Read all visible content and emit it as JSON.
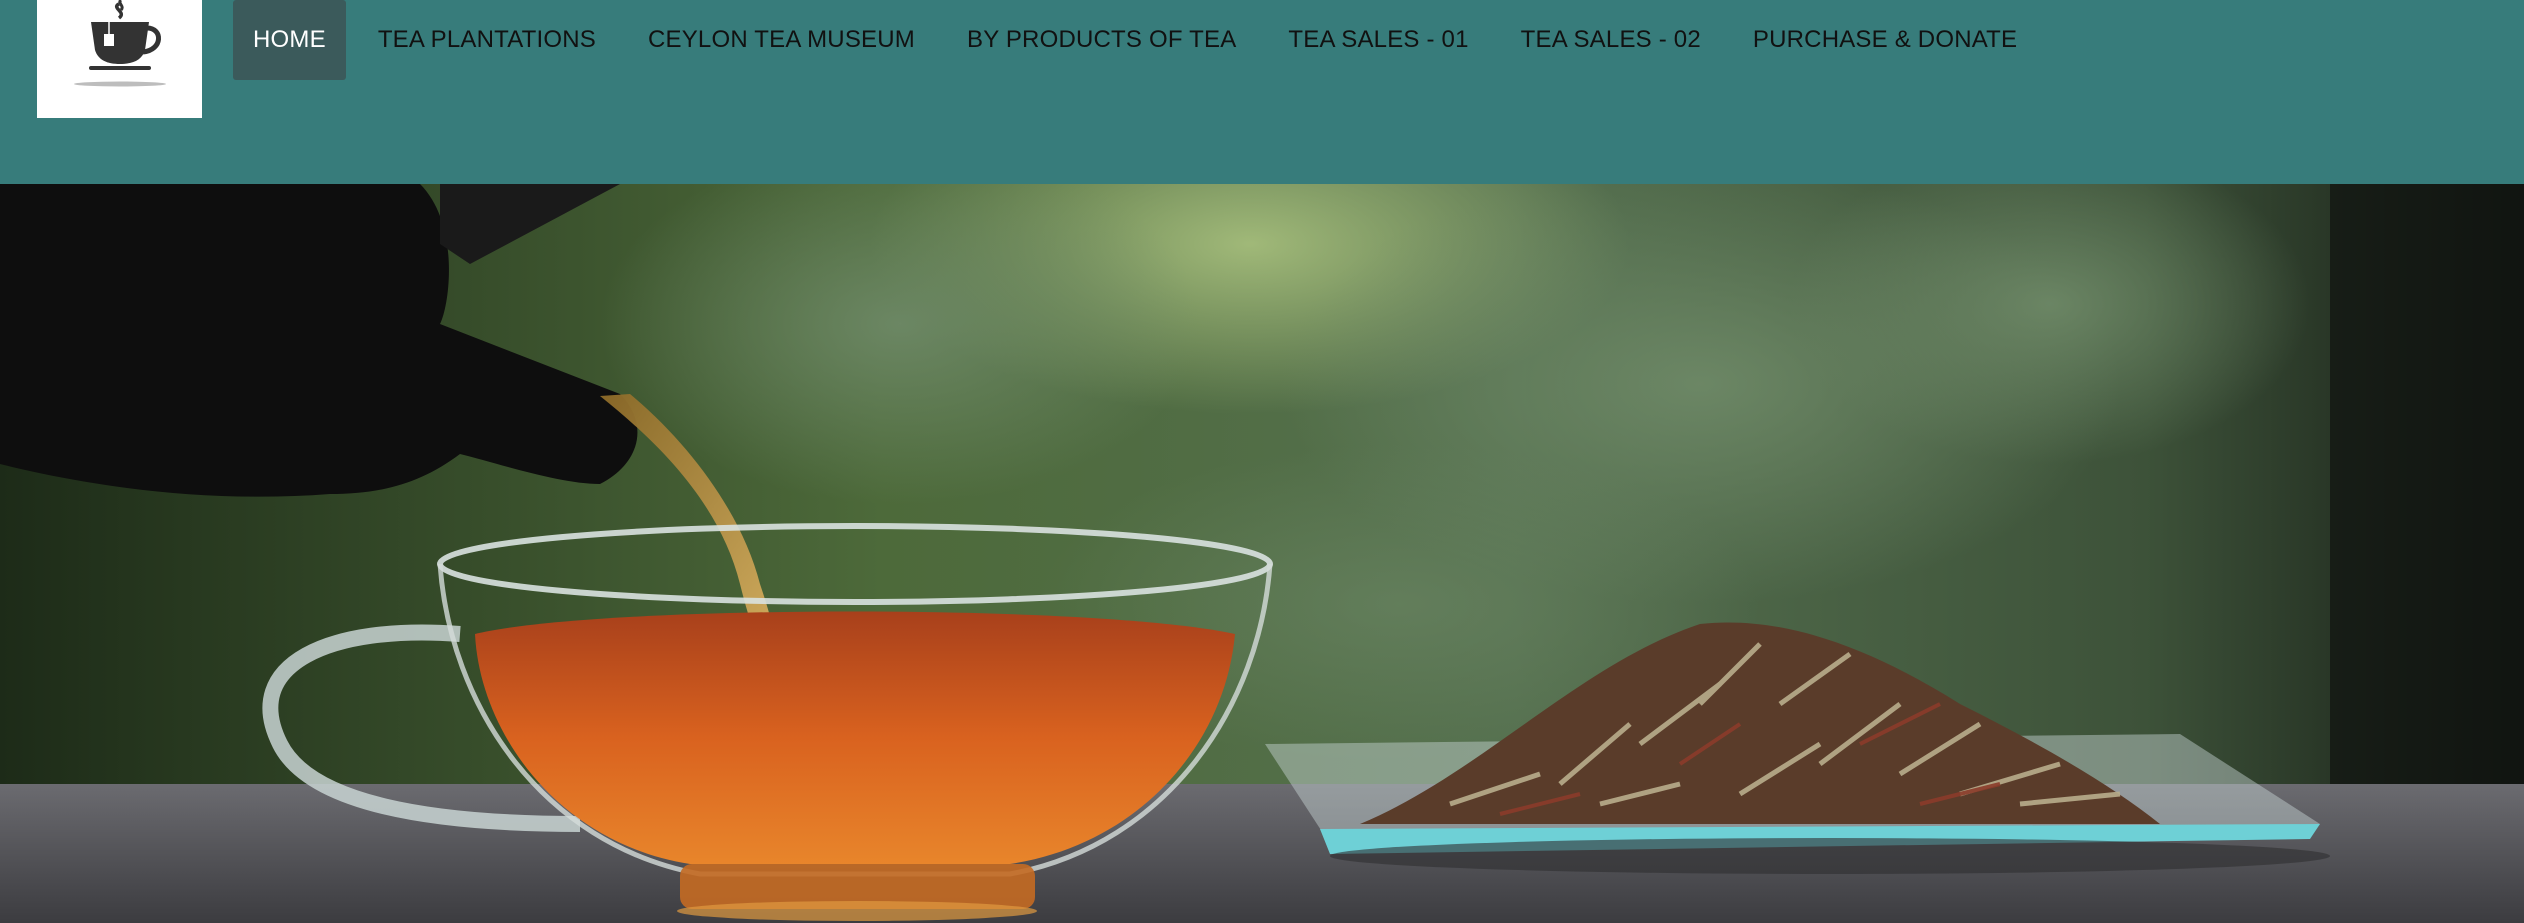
{
  "header": {
    "logo_icon": "tea-cup-icon",
    "nav": [
      {
        "label": "HOME",
        "active": true
      },
      {
        "label": "TEA PLANTATIONS",
        "active": false
      },
      {
        "label": "CEYLON TEA MUSEUM",
        "active": false
      },
      {
        "label": "BY PRODUCTS OF TEA",
        "active": false
      },
      {
        "label": "TEA SALES - 01",
        "active": false
      },
      {
        "label": "TEA SALES - 02",
        "active": false
      },
      {
        "label": "PURCHASE & DONATE",
        "active": false
      }
    ]
  },
  "colors": {
    "header_bg": "#377c7b",
    "active_nav_bg": "#3b5a5b",
    "logo_bg": "#ffffff"
  }
}
